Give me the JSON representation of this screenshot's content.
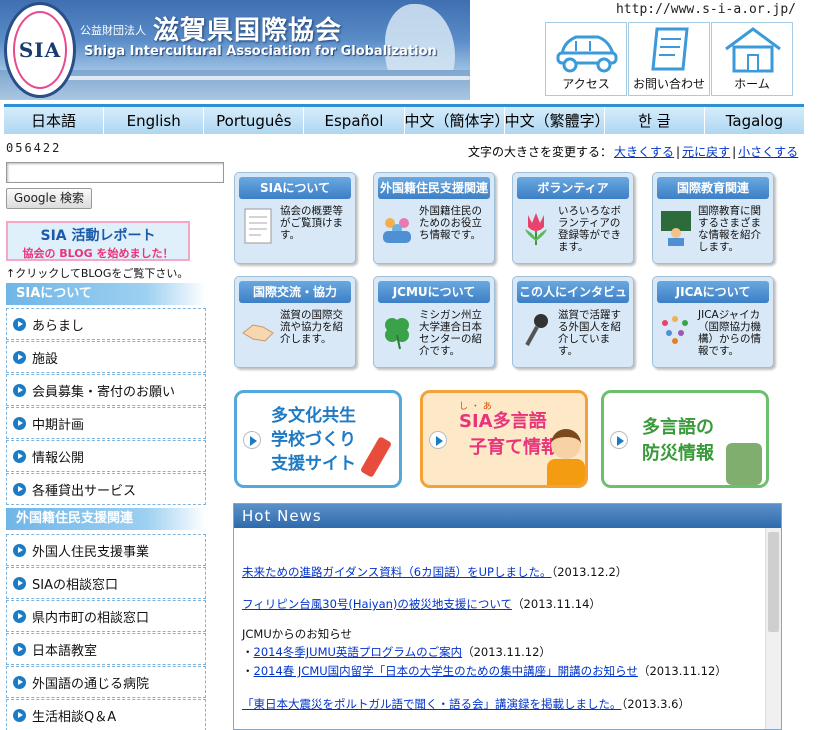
{
  "header": {
    "url": "http://www.s-i-a.or.jp/",
    "org_prefix": "公益財団法人",
    "org_name": "滋賀県国際協会",
    "org_name_en": "Shiga Intercultural Association for Globalization",
    "logo_text": "SIA",
    "buttons": [
      {
        "label": "アクセス",
        "icon": "car-icon"
      },
      {
        "label": "お問い合わせ",
        "icon": "document-icon"
      },
      {
        "label": "ホーム",
        "icon": "house-icon"
      }
    ]
  },
  "languages": [
    "日本語",
    "English",
    "Português",
    "Español",
    "中文（簡体字）",
    "中文（繁體字）",
    "한 글",
    "Tagalog"
  ],
  "counter": "056422",
  "search": {
    "value": "",
    "button": "Google 検索"
  },
  "report_banner": {
    "title": "SIA 活動レポート",
    "subtitle": "協会の BLOG を始めました！",
    "note": "↑クリックしてBLOGをご覧下さい。"
  },
  "font_size": {
    "label": "文字の大きさを変更する：",
    "larger": "大きくする",
    "reset": "元に戻す",
    "smaller": "小さくする"
  },
  "sidebar": {
    "section1": {
      "title": "SIAについて",
      "items": [
        "あらまし",
        "施設",
        "会員募集・寄付のお願い",
        "中期計画",
        "情報公開",
        "各種貸出サービス"
      ]
    },
    "section2": {
      "title": "外国籍住民支援関連",
      "items": [
        "外国人住民支援事業",
        "SIAの相談窓口",
        "県内市町の相談窓口",
        "日本語教室",
        "外国語の通じる病院",
        "生活相談Q＆A"
      ]
    }
  },
  "tiles": [
    {
      "title": "SIAについて",
      "text": "協会の概要等がご覧頂けます。",
      "icon": "document-icon"
    },
    {
      "title": "外国籍住民支援関連",
      "text": "外国籍住民のためのお役立ち情報です。",
      "icon": "people-icon"
    },
    {
      "title": "ボランティア",
      "text": "いろいろなボランティアの登録等ができます。",
      "icon": "tulip-icon"
    },
    {
      "title": "国際教育関連",
      "text": "国際教育に関するさまざまな情報を紹介します。",
      "icon": "teacher-icon"
    },
    {
      "title": "国際交流・協力",
      "text": "滋賀の国際交流や協力を紹介します。",
      "icon": "handshake-icon"
    },
    {
      "title": "JCMUについて",
      "text": "ミシガン州立大学連合日本センターの紹介です。",
      "icon": "clover-icon"
    },
    {
      "title": "この人にインタビュー",
      "text": "滋賀で活躍する外国人を紹介しています。",
      "icon": "microphone-icon"
    },
    {
      "title": "JICAについて",
      "text": "JICAジャイカ（国際協力機構）からの情報です。",
      "icon": "dots-icon"
    }
  ],
  "banners": {
    "school": {
      "line1": "多文化共生",
      "line2": "学校づくり",
      "line3": "支援サイト"
    },
    "childcare": {
      "ruby": "し ・ あ",
      "line1": "SIA多言語",
      "line2": "子育て情報"
    },
    "disaster": {
      "line1": "多言語の",
      "line2": "防災情報"
    }
  },
  "news": {
    "title": "Hot News",
    "items": [
      {
        "link": "未来ための進路ガイダンス資料（6カ国語）をUPしました。",
        "date": "（2013.12.2）"
      },
      {
        "link": "フィリピン台風30号(Haiyan)の被災地支援について",
        "date": "（2013.11.14）"
      },
      {
        "plain": "JCMUからのお知らせ"
      },
      {
        "prefix": "・",
        "link": "2014冬季JUMU英語プログラムのご案内",
        "date": "（2013.11.12）"
      },
      {
        "prefix": "・",
        "link": "2014春 JCMU国内留学「日本の大学生のための集中講座」開講のお知らせ",
        "date": "（2013.11.12）"
      },
      {
        "link": "「東日本大震災をポルトガル語で聞く・語る会」講演録を掲載しました。",
        "date": "（2013.3.6）"
      }
    ]
  }
}
